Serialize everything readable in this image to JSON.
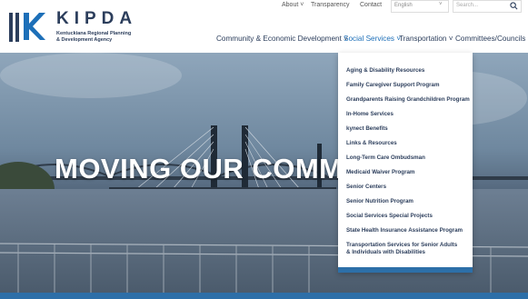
{
  "logo": {
    "name": "KIPDA",
    "subtitle_line1": "Kentuckiana Regional Planning",
    "subtitle_line2": "& Development Agency"
  },
  "utility_nav": {
    "about": "About ˅",
    "transparency": "Transparency",
    "contact": "Contact",
    "language": "English",
    "search_placeholder": "Search..."
  },
  "main_nav": [
    {
      "label": "Community & Economic Development ˅"
    },
    {
      "label": "Social Services ˅"
    },
    {
      "label": "Transportation ˅"
    },
    {
      "label": "Committees/Councils ˅"
    }
  ],
  "hero": {
    "title": "MOVING OUR COMMUNIT"
  },
  "dropdown": {
    "items": [
      "Aging & Disability Resources",
      "Family Caregiver Support Program",
      "Grandparents Raising Grandchildren Program",
      "In-Home Services",
      "kynect Benefits",
      "Links & Resources",
      "Long-Term Care Ombudsman",
      "Medicaid Waiver Program",
      "Senior Centers",
      "Senior Nutrition Program",
      "Social Services Special Projects",
      "State Health Insurance Assistance Program",
      "Transportation Services for Senior Adults",
      "& Individuals with Disabilities"
    ]
  },
  "colors": {
    "brand": "#2c3e5c",
    "accent": "#1d6fb8",
    "bar": "#2d6fa8"
  }
}
